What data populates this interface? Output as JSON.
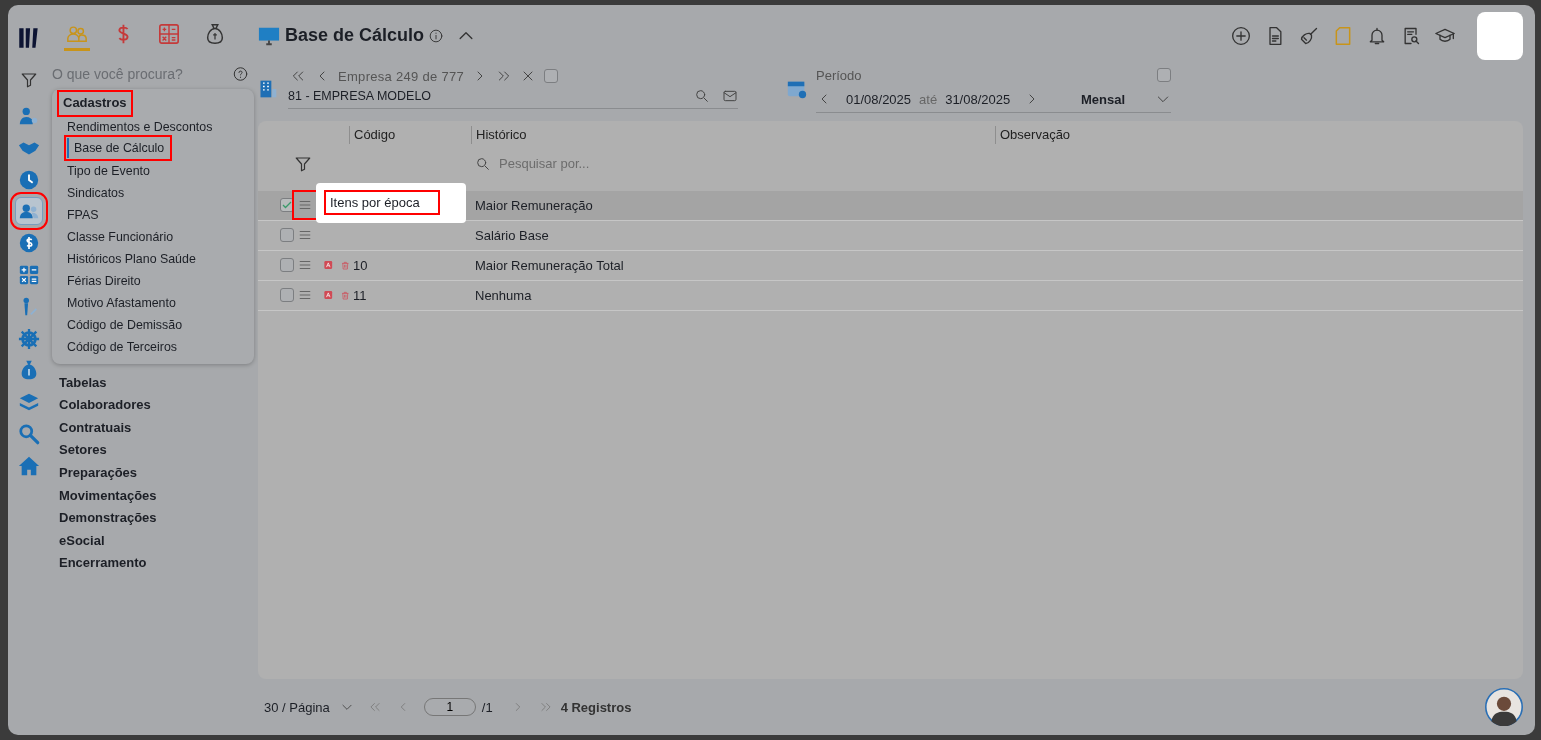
{
  "top_apps": [
    {
      "selected": true
    },
    {
      "selected": false
    },
    {
      "selected": false
    },
    {
      "selected": false
    }
  ],
  "search": {
    "placeholder": "O que você procura?"
  },
  "side_nav": [
    {
      "selected": false,
      "highlighted": false
    },
    {
      "selected": false,
      "highlighted": false
    },
    {
      "selected": false,
      "highlighted": false
    },
    {
      "selected": true,
      "highlighted": true
    },
    {
      "selected": false,
      "highlighted": false
    },
    {
      "selected": false,
      "highlighted": false
    },
    {
      "selected": false,
      "highlighted": false
    },
    {
      "selected": false,
      "highlighted": false
    },
    {
      "selected": false,
      "highlighted": false
    },
    {
      "selected": false,
      "highlighted": false
    },
    {
      "selected": false,
      "highlighted": false
    },
    {
      "selected": false,
      "highlighted": false
    }
  ],
  "menu": [
    {
      "label": "Cadastros",
      "expanded": true,
      "highlighted": true,
      "children": [
        {
          "label": "Rendimentos e Descontos",
          "selected": false,
          "highlighted": false
        },
        {
          "label": "Base de Cálculo",
          "selected": true,
          "highlighted": true
        },
        {
          "label": "Tipo de Evento",
          "selected": false,
          "highlighted": false
        },
        {
          "label": "Sindicatos",
          "selected": false,
          "highlighted": false
        },
        {
          "label": "FPAS",
          "selected": false,
          "highlighted": false
        },
        {
          "label": "Classe Funcionário",
          "selected": false,
          "highlighted": false
        },
        {
          "label": "Históricos Plano Saúde",
          "selected": false,
          "highlighted": false
        },
        {
          "label": "Férias Direito",
          "selected": false,
          "highlighted": false
        },
        {
          "label": "Motivo Afastamento",
          "selected": false,
          "highlighted": false
        },
        {
          "label": "Código de Demissão",
          "selected": false,
          "highlighted": false
        },
        {
          "label": "Código de Terceiros",
          "selected": false,
          "highlighted": false
        }
      ]
    },
    {
      "label": "Tabelas",
      "expanded": false,
      "highlighted": false
    },
    {
      "label": "Colaboradores",
      "expanded": false,
      "highlighted": false
    },
    {
      "label": "Contratuais",
      "expanded": false,
      "highlighted": false
    },
    {
      "label": "Setores",
      "expanded": false,
      "highlighted": false
    },
    {
      "label": "Preparações",
      "expanded": false,
      "highlighted": false
    },
    {
      "label": "Movimentações",
      "expanded": false,
      "highlighted": false
    },
    {
      "label": "Demonstrações",
      "expanded": false,
      "highlighted": false
    },
    {
      "label": "eSocial",
      "expanded": false,
      "highlighted": false
    },
    {
      "label": "Encerramento",
      "expanded": false,
      "highlighted": false
    }
  ],
  "page": {
    "title": "Base de Cálculo"
  },
  "company": {
    "position": "Empresa 249 de 777",
    "checked": false,
    "value": "81 - EMPRESA MODELO"
  },
  "period": {
    "label": "Período",
    "from": "01/08/2025",
    "separator": "até",
    "to": "31/08/2025",
    "mode": "Mensal",
    "checked": false
  },
  "table": {
    "columns": [
      "Código",
      "Histórico",
      "Observação"
    ],
    "search_placeholder": "Pesquisar por...",
    "rows": [
      {
        "checked": true,
        "selected": true,
        "menu_highlighted": true,
        "historico": "Maior Remuneração"
      },
      {
        "checked": false,
        "selected": false,
        "menu_highlighted": false,
        "historico": "Salário Base"
      },
      {
        "checked": false,
        "selected": false,
        "menu_highlighted": false,
        "code": "10",
        "historico": "Maior Remuneração Total"
      },
      {
        "checked": false,
        "selected": false,
        "menu_highlighted": false,
        "code": "11",
        "historico": "Nenhuma"
      }
    ],
    "popup": {
      "label": "Itens por época",
      "highlighted": true
    }
  },
  "pagination": {
    "page_size": "30 / Página",
    "page": "1",
    "total_pages": "/1",
    "records": "4 Registros"
  }
}
